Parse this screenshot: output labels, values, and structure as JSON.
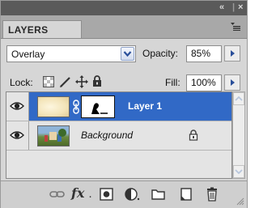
{
  "panel": {
    "tab_label": "LAYERS",
    "collapse_glyph": "«",
    "close_glyph": "×"
  },
  "blend": {
    "mode": "Overlay",
    "opacity_label": "Opacity:",
    "opacity_value": "85%"
  },
  "lock": {
    "label": "Lock:",
    "fill_label": "Fill:",
    "fill_value": "100%"
  },
  "layers": [
    {
      "name": "Layer 1",
      "selected": true,
      "visible": true,
      "has_mask": true,
      "locked": false
    },
    {
      "name": "Background",
      "selected": false,
      "visible": true,
      "has_mask": false,
      "locked": true
    }
  ],
  "footer": {
    "fx_label": "fx"
  },
  "colors": {
    "selection": "#3169c6",
    "panel_bg": "#d6d6d6",
    "header_bg": "#5a5a5a"
  }
}
